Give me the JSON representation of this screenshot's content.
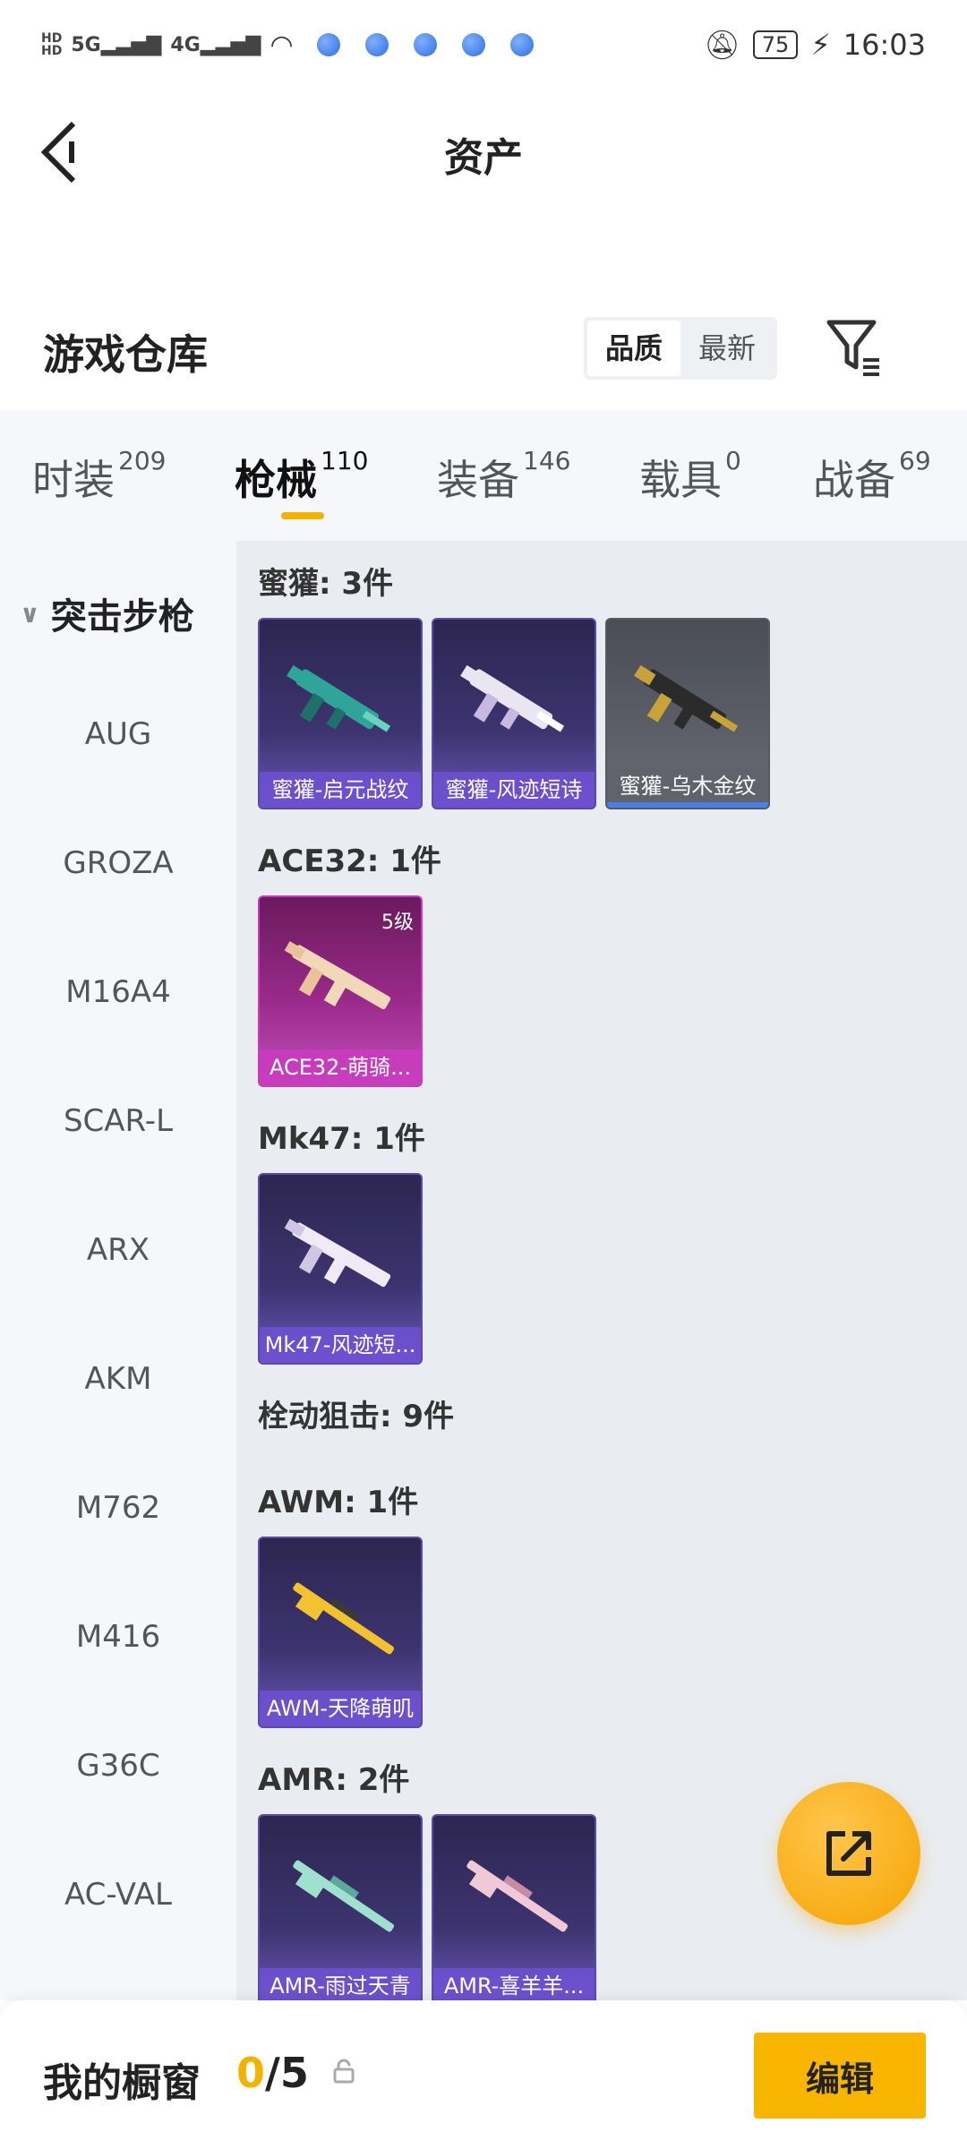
{
  "status_bar": {
    "left_text_top": "HD",
    "left_text_bottom": "HD",
    "net1": "5G",
    "net2": "4G",
    "battery": "75",
    "time": "16:03"
  },
  "header": {
    "title": "资产"
  },
  "warehouse": {
    "title": "游戏仓库",
    "sort_options": [
      "品质",
      "最新"
    ],
    "sort_active": "品质"
  },
  "tabs": [
    {
      "label": "时装",
      "count": "209"
    },
    {
      "label": "枪械",
      "count": "110"
    },
    {
      "label": "装备",
      "count": "146"
    },
    {
      "label": "载具",
      "count": "0"
    },
    {
      "label": "战备",
      "count": "69"
    }
  ],
  "sidebar": {
    "category": "突击步枪",
    "items": [
      "AUG",
      "GROZA",
      "M16A4",
      "SCAR-L",
      "ARX",
      "AKM",
      "M762",
      "M416",
      "G36C",
      "AC-VAL"
    ]
  },
  "groups": [
    {
      "title": "蜜獾: 3件",
      "cards": [
        {
          "label": "蜜獾-启元战纹",
          "style": "purple"
        },
        {
          "label": "蜜獾-风迹短诗",
          "style": "purple"
        },
        {
          "label": "蜜獾-乌木金纹",
          "style": "gray"
        }
      ]
    },
    {
      "title": "ACE32: 1件",
      "cards": [
        {
          "label": "ACE32-萌骑...",
          "style": "pink",
          "level": "5级"
        }
      ]
    },
    {
      "title": "Mk47: 1件",
      "cards": [
        {
          "label": "Mk47-风迹短...",
          "style": "purple"
        }
      ]
    },
    {
      "title": "栓动狙击: 9件",
      "cards": []
    },
    {
      "title": "AWM: 1件",
      "cards": [
        {
          "label": "AWM-天降萌叽",
          "style": "purple"
        }
      ]
    },
    {
      "title": "AMR: 2件",
      "cards": [
        {
          "label": "AMR-雨过天青",
          "style": "purple"
        },
        {
          "label": "AMR-喜羊羊...",
          "style": "purple"
        }
      ]
    }
  ],
  "bottom_bar": {
    "title": "我的橱窗",
    "current": "0",
    "sep_total": "/5",
    "edit_label": "编辑"
  },
  "colors": {
    "accent": "#f7b500",
    "tab_underline": "#f3b100"
  }
}
